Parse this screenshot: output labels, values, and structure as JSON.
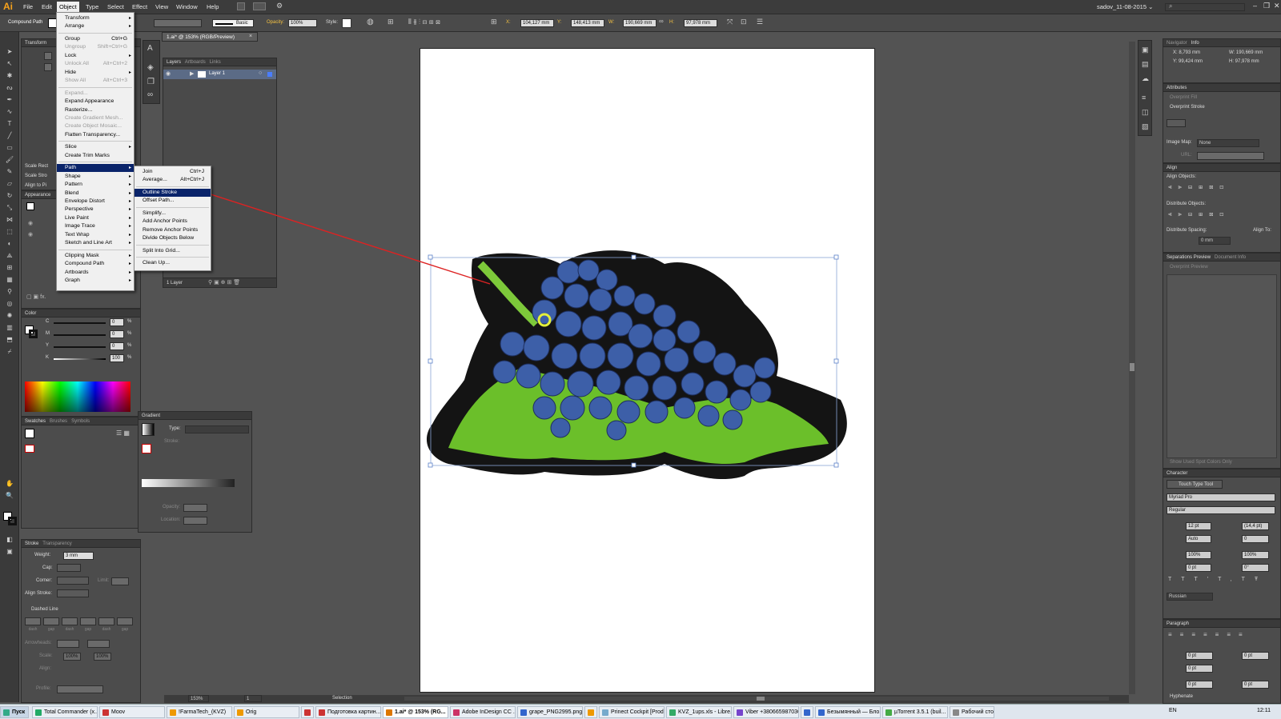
{
  "menubar": {
    "logo": "Ai",
    "items": [
      "File",
      "Edit",
      "Object",
      "Type",
      "Select",
      "Effect",
      "View",
      "Window",
      "Help"
    ],
    "workspace": "sadov_11-08-2015 ⌄"
  },
  "control": {
    "type_label": "Compound Path",
    "stroke_style": "Basic",
    "opacity_label": "Opacity:",
    "opacity_value": "100%",
    "style_label": "Style:",
    "x_label": "X:",
    "x_value": "104,127 mm",
    "y_label": "Y:",
    "y_value": "148,413 mm",
    "w_label": "W:",
    "w_value": "190,669 mm",
    "h_label": "H:",
    "h_value": "97,978 mm"
  },
  "doc_tab": {
    "title": "1.ai* @ 153% (RGB/Preview)",
    "close": "×"
  },
  "object_menu": {
    "items": [
      {
        "label": "Transform",
        "arrow": "▸"
      },
      {
        "label": "Arrange",
        "arrow": "▸"
      },
      {
        "sep": true
      },
      {
        "label": "Group",
        "shortcut": "Ctrl+G"
      },
      {
        "label": "Ungroup",
        "shortcut": "Shift+Ctrl+G",
        "disabled": true
      },
      {
        "label": "Lock",
        "arrow": "▸"
      },
      {
        "label": "Unlock All",
        "shortcut": "Alt+Ctrl+2",
        "disabled": true
      },
      {
        "label": "Hide",
        "arrow": "▸"
      },
      {
        "label": "Show All",
        "shortcut": "Alt+Ctrl+3",
        "disabled": true
      },
      {
        "sep": true
      },
      {
        "label": "Expand...",
        "disabled": true
      },
      {
        "label": "Expand Appearance"
      },
      {
        "label": "Rasterize..."
      },
      {
        "label": "Create Gradient Mesh...",
        "disabled": true
      },
      {
        "label": "Create Object Mosaic...",
        "disabled": true
      },
      {
        "label": "Flatten Transparency..."
      },
      {
        "sep": true
      },
      {
        "label": "Slice",
        "arrow": "▸"
      },
      {
        "label": "Create Trim Marks"
      },
      {
        "sep": true
      },
      {
        "label": "Path",
        "arrow": "▸",
        "highlight": true
      },
      {
        "label": "Shape",
        "arrow": "▸"
      },
      {
        "label": "Pattern",
        "arrow": "▸"
      },
      {
        "label": "Blend",
        "arrow": "▸"
      },
      {
        "label": "Envelope Distort",
        "arrow": "▸"
      },
      {
        "label": "Perspective",
        "arrow": "▸"
      },
      {
        "label": "Live Paint",
        "arrow": "▸"
      },
      {
        "label": "Image Trace",
        "arrow": "▸"
      },
      {
        "label": "Text Wrap",
        "arrow": "▸"
      },
      {
        "label": "Sketch and Line Art",
        "arrow": "▸"
      },
      {
        "sep": true
      },
      {
        "label": "Clipping Mask",
        "arrow": "▸"
      },
      {
        "label": "Compound Path",
        "arrow": "▸"
      },
      {
        "label": "Artboards",
        "arrow": "▸"
      },
      {
        "label": "Graph",
        "arrow": "▸"
      }
    ]
  },
  "path_menu": {
    "items": [
      {
        "label": "Join",
        "shortcut": "Ctrl+J"
      },
      {
        "label": "Average...",
        "shortcut": "Alt+Ctrl+J"
      },
      {
        "sep": true
      },
      {
        "label": "Outline Stroke",
        "highlight": true
      },
      {
        "label": "Offset Path..."
      },
      {
        "sep": true
      },
      {
        "label": "Simplify..."
      },
      {
        "label": "Add Anchor Points"
      },
      {
        "label": "Remove Anchor Points"
      },
      {
        "label": "Divide Objects Below"
      },
      {
        "sep": true
      },
      {
        "label": "Split Into Grid..."
      },
      {
        "sep": true
      },
      {
        "label": "Clean Up..."
      }
    ]
  },
  "layers": {
    "tabs": [
      "Layers",
      "Artboards",
      "Links"
    ],
    "layer_name": "Layer 1",
    "footer": "1 Layer"
  },
  "left_panels": {
    "transform": "Transform",
    "scale_rect": "Scale Rect",
    "scale_strokes": "Scale Stro",
    "align_pixel": "Align to Pi",
    "appearance": "Appearance",
    "color": "Color",
    "c": "C",
    "m": "M",
    "y": "Y",
    "k": "K",
    "c_val": "0",
    "m_val": "0",
    "y_val": "0",
    "k_val": "100",
    "pct": "%",
    "swatches_tabs": [
      "Swatches",
      "Brushes",
      "Symbols"
    ]
  },
  "gradient": {
    "title": "Gradient",
    "type_label": "Type:",
    "stroke_label": "Stroke:",
    "opacity_label": "Opacity:",
    "location_label": "Location:"
  },
  "stroke": {
    "tabs": [
      "Stroke",
      "Transparency"
    ],
    "weight_label": "Weight:",
    "weight": "3 mm",
    "cap_label": "Cap:",
    "corner_label": "Corner:",
    "limit_label": "Limit:",
    "align_label": "Align Stroke:",
    "dashed_label": "Dashed Line",
    "dash_labels": [
      "dash",
      "gap",
      "dash",
      "gap",
      "dash",
      "gap"
    ],
    "arrowheads_label": "Arrowheads:",
    "scale_label": "Scale:",
    "scale_1": "100%",
    "scale_2": "100%",
    "align2_label": "Align:",
    "profile_label": "Profile:"
  },
  "right": {
    "nav_tabs": [
      "Navigator",
      "Info"
    ],
    "x": "X: 8,793 mm",
    "y": "Y: 99,424 mm",
    "w": "W: 190,669 mm",
    "h": "H: 97,978 mm",
    "attributes": "Attributes",
    "overprint_fill": "Overprint Fill",
    "overprint_stroke": "Overprint Stroke",
    "image_map_label": "Image Map:",
    "image_map_value": "None",
    "url_label": "URL:",
    "align": "Align",
    "align_objects": "Align Objects:",
    "distribute_objects": "Distribute Objects:",
    "distribute_spacing": "Distribute Spacing:",
    "align_to": "Align To:",
    "spacing": "0 mm",
    "sep_tabs": [
      "Separations Preview",
      "Document Info"
    ],
    "overprint_preview": "Overprint Preview",
    "show_spot": "Show Used Spot Colors Only",
    "character": "Character",
    "touch_type": "Touch Type Tool",
    "font": "Myriad Pro",
    "style": "Regular",
    "size": "12 pt",
    "leading": "(14,4 pt)",
    "kerning": "Auto",
    "tracking": "0",
    "hscale": "100%",
    "vscale": "100%",
    "baseline": "0 pt",
    "rotate": "0°",
    "language": "Russian",
    "paragraph": "Paragraph",
    "indent": "0 pt",
    "hyphenate": "Hyphenate"
  },
  "status": {
    "zoom": "153%",
    "page": "1",
    "tool": "Selection"
  },
  "taskbar": {
    "start": "Пуск",
    "tasks": [
      "Total Commander (x...",
      "Moov",
      "!FarmaTech_(KVZ)",
      "Orig",
      "",
      "Подготовка картин...",
      "1.ai* @ 153% (RG...",
      "Adobe InDesign CC ...",
      "grape_PNG2995.png...",
      "",
      "Prinect Cockpit [Prod...",
      "KVZ_1ups.xls - Libre...",
      "Viber +380665987030",
      "",
      "Безымянный — Бло...",
      "µTorrent 3.5.1 (buil...",
      "Рабочий стол"
    ],
    "lang": "EN",
    "time": "12:11"
  }
}
